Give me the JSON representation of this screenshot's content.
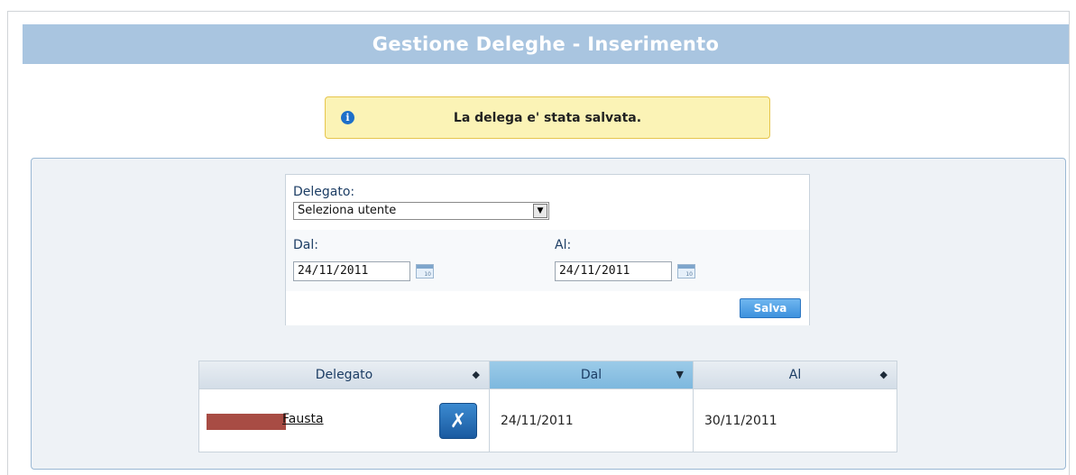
{
  "header": {
    "title": "Gestione Deleghe - Inserimento"
  },
  "message": {
    "text": "La delega e' stata salvata.",
    "icon": "info-icon"
  },
  "form": {
    "delegato_label": "Delegato:",
    "delegato_selected": "Seleziona utente",
    "dal_label": "Dal:",
    "dal_value": "24/11/2011",
    "al_label": "Al:",
    "al_value": "24/11/2011",
    "save_label": "Salva"
  },
  "grid": {
    "columns": [
      {
        "label": "Delegato",
        "sort": "both"
      },
      {
        "label": "Dal",
        "sort": "desc"
      },
      {
        "label": "Al",
        "sort": "both"
      }
    ],
    "rows": [
      {
        "delegato": "Fausta",
        "dal": "24/11/2011",
        "al": "30/11/2011"
      }
    ]
  }
}
